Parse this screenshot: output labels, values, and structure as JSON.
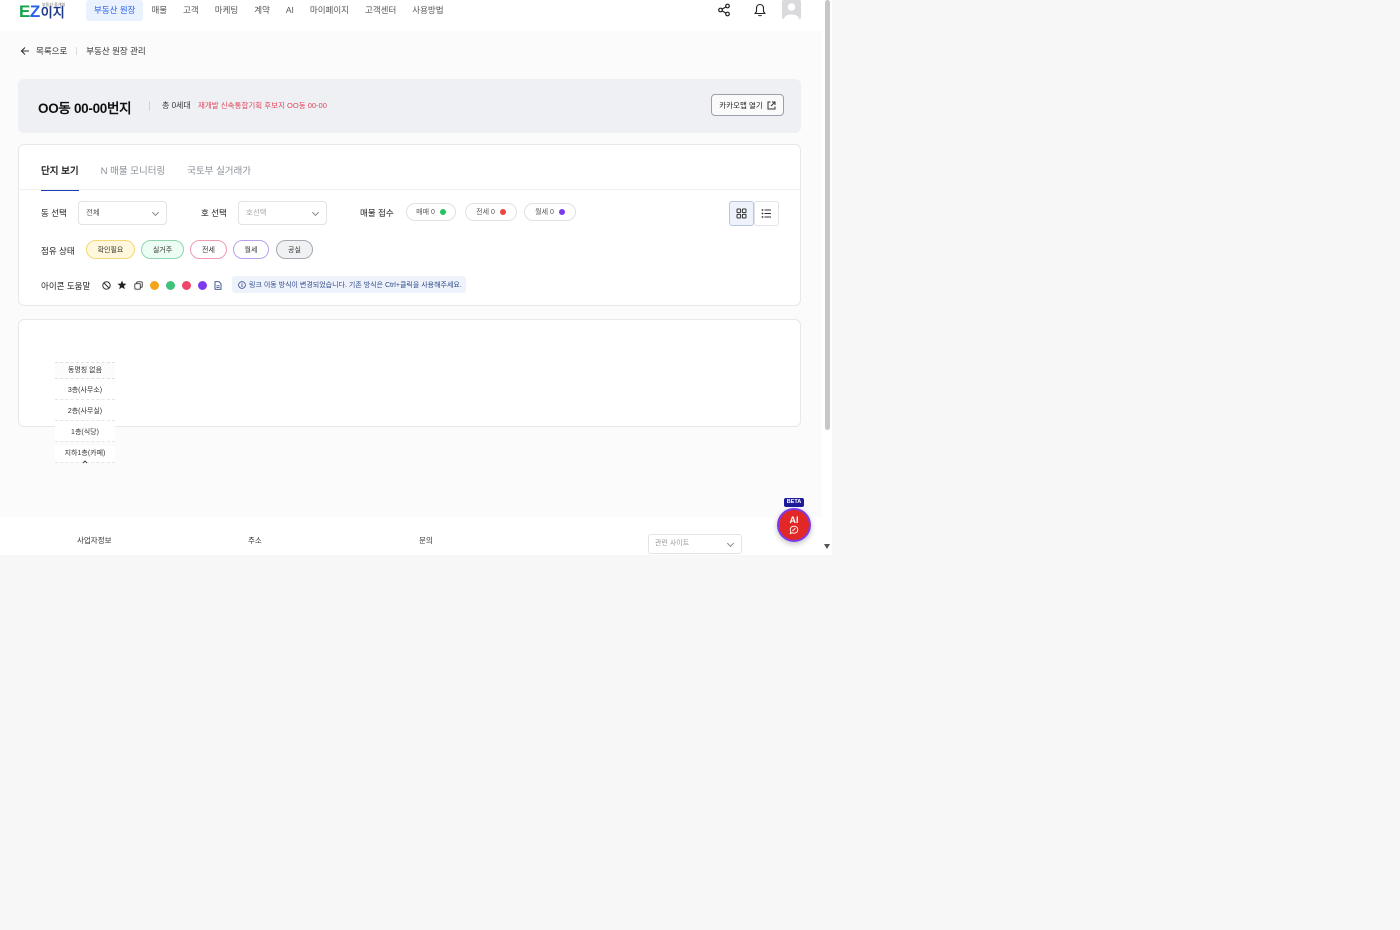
{
  "header": {
    "logo_en": "EZ",
    "logo_kr": "이지",
    "logo_tagline": "부동산 중개의",
    "nav": [
      "부동산 원장",
      "매물",
      "고객",
      "마케팅",
      "계약",
      "AI",
      "마이페이지",
      "고객센터",
      "사용방법"
    ],
    "active_nav": "부동산 원장"
  },
  "breadcrumb": {
    "back_label": "목록으로",
    "current": "부동산 원장 관리"
  },
  "title_card": {
    "title": "OO동 00-00번지",
    "count": "총 0세대",
    "notice": "재개발 신속통합기획 후보지 OO동 00-00",
    "kakao_button": "카카오맵 열기"
  },
  "tabs": [
    "단지 보기",
    "N 매물 모니터링",
    "국토부 실거래가"
  ],
  "active_tab": "단지 보기",
  "filters": {
    "dong_label": "동 선택",
    "dong_value": "전체",
    "ho_label": "호 선택",
    "ho_placeholder": "호선택",
    "listing_label": "매물 접수",
    "listings": [
      {
        "label": "매매 0",
        "color": "#22c55e"
      },
      {
        "label": "전세 0",
        "color": "#ef4444"
      },
      {
        "label": "월세 0",
        "color": "#7c3aed"
      }
    ],
    "occupancy_label": "점유 상태",
    "occupancy": [
      {
        "label": "확인필요",
        "bg": "#fff8dc",
        "border": "#f3d877"
      },
      {
        "label": "실거주",
        "bg": "#ecfdf3",
        "border": "#8fd6ae"
      },
      {
        "label": "전세",
        "bg": "#ffffff",
        "border": "#f19ab0"
      },
      {
        "label": "월세",
        "bg": "#ffffff",
        "border": "#b9a2ea"
      },
      {
        "label": "공실",
        "bg": "#f0f1f3",
        "border": "#a6a9b0"
      }
    ],
    "icon_help_label": "아이콘 도움말",
    "legend_colors": [
      "#f5a51b",
      "#3ec27a",
      "#f0456a",
      "#7c3aed"
    ],
    "info_text": "링크 이동 방식이 변경되었습니다. 기존 방식은 Ctrl+클릭을 사용해주세요."
  },
  "building": {
    "header": "동명칭 없음",
    "floors": [
      "3층(사무소)",
      "2층(사무실)",
      "1층(식당)",
      "지하1층(카페)"
    ]
  },
  "footer": {
    "business_info": "사업자정보",
    "address": "주소",
    "inquiry": "문의",
    "related_sites_placeholder": "관련 사이트"
  },
  "ai_fab": {
    "label": "AI",
    "badge": "BETA"
  }
}
